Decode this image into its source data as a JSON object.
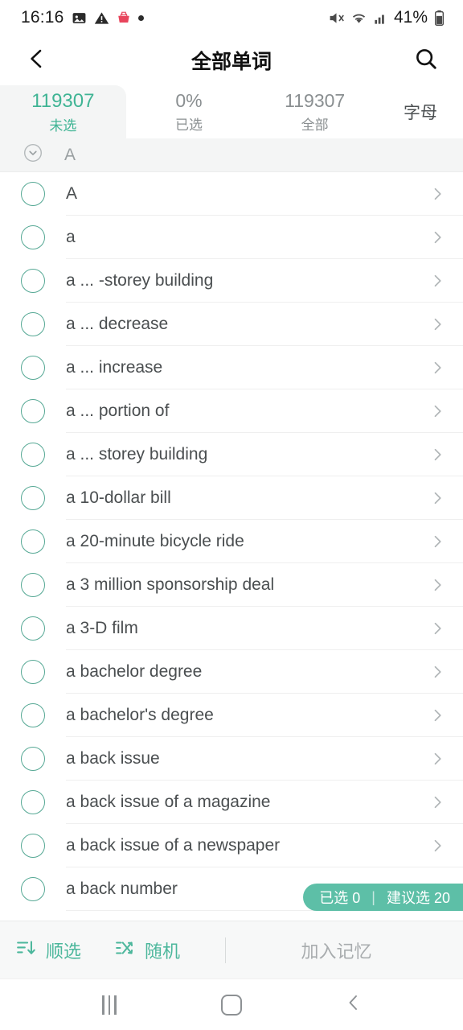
{
  "statusbar": {
    "time": "16:16",
    "battery_pct": "41%",
    "icons": [
      "image-icon",
      "warning-icon",
      "app-notification-icon",
      "dot-icon",
      "mute-icon",
      "wifi-icon",
      "signal-icon",
      "battery-icon"
    ]
  },
  "header": {
    "title": "全部单词",
    "back_icon": "back-chevron-icon",
    "search_icon": "search-icon"
  },
  "tabs": [
    {
      "value": "119307",
      "label": "未选",
      "active": true
    },
    {
      "value": "0%",
      "label": "已选",
      "active": false
    },
    {
      "value": "119307",
      "label": "全部",
      "active": false
    }
  ],
  "sort_tab": {
    "label": "字母"
  },
  "section": {
    "letter": "A",
    "collapse_icon": "chevron-down-circle-icon"
  },
  "words": [
    "A",
    "a",
    "a ... -storey building",
    "a ... decrease",
    "a ... increase",
    "a ... portion of",
    "a ... storey building",
    "a 10-dollar bill",
    "a 20-minute bicycle ride",
    "a 3 million sponsorship deal",
    "a 3-D film",
    "a bachelor degree",
    "a bachelor's degree",
    "a back issue",
    "a back issue of a magazine",
    "a back issue of a newspaper",
    "a back number"
  ],
  "selection_badge": {
    "selected_label": "已选 0",
    "separator": "|",
    "suggested_label": "建议选 20"
  },
  "toolbar": {
    "sort_select_label": "顺选",
    "sort_select_icon": "sort-descending-icon",
    "random_label": "随机",
    "random_icon": "shuffle-icon",
    "action_label": "加入记忆"
  },
  "navbar": {
    "recents_icon": "recents-icon",
    "home_icon": "home-icon",
    "back_icon": "back-icon"
  },
  "colors": {
    "accent_teal": "#3fb494",
    "badge_teal": "#5dbfa7",
    "checkbox_teal": "#55a894",
    "muted_gray": "#8a8f91"
  }
}
